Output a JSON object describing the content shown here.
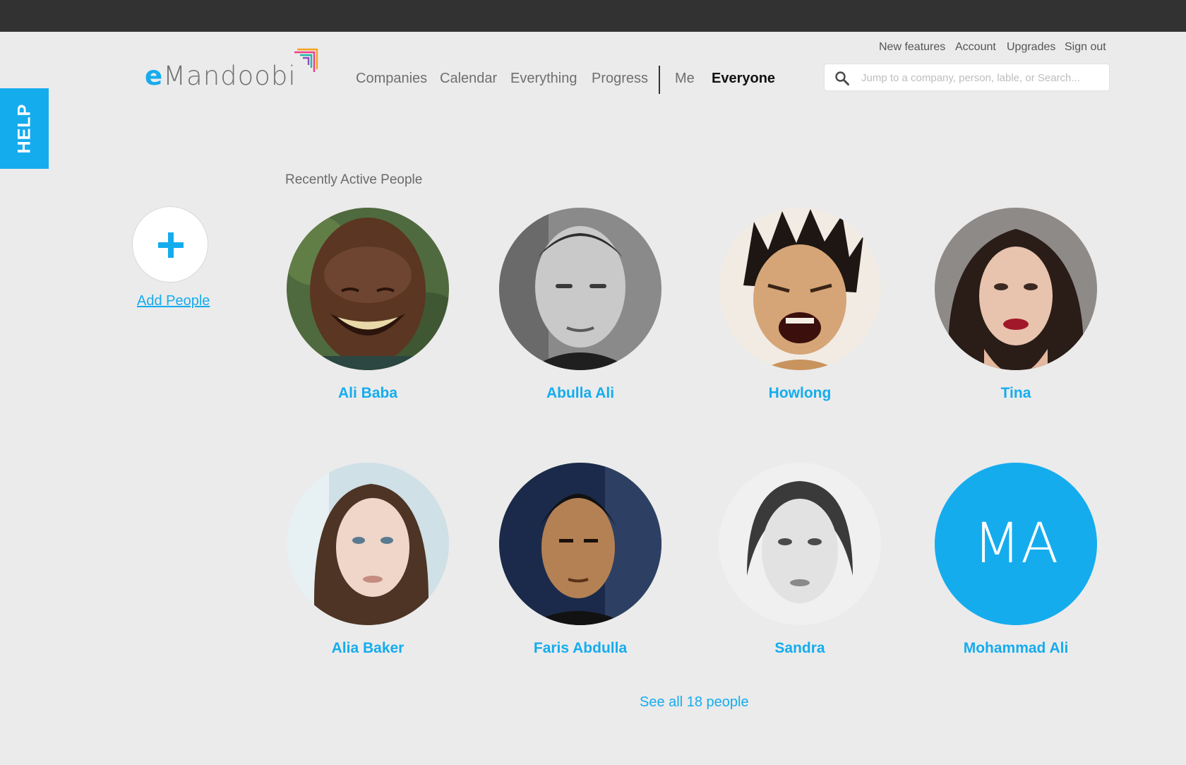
{
  "header": {
    "logo": {
      "e": "e",
      "rest": "Mandoobi"
    },
    "utility_links": [
      "New features",
      "Account",
      "Upgrades",
      "Sign out"
    ],
    "nav": [
      "Companies",
      "Calendar",
      "Everything",
      "Progress",
      "Me",
      "Everyone"
    ],
    "active_nav": "Everyone",
    "search": {
      "placeholder": "Jump to a company, person, lable, or Search..."
    }
  },
  "help_tab": {
    "label": "HELP"
  },
  "main": {
    "section_title": "Recently Active People",
    "add_people": {
      "label": "Add People"
    },
    "people": [
      {
        "name": "Ali Baba",
        "type": "photo"
      },
      {
        "name": "Abulla Ali",
        "type": "photo"
      },
      {
        "name": "Howlong",
        "type": "photo"
      },
      {
        "name": "Tina",
        "type": "photo"
      },
      {
        "name": "Alia Baker",
        "type": "photo"
      },
      {
        "name": "Faris Abdulla",
        "type": "photo"
      },
      {
        "name": "Sandra",
        "type": "photo"
      },
      {
        "name": "Mohammad Ali",
        "type": "initials",
        "initials": "MA"
      }
    ],
    "see_all": "See all 18 people"
  },
  "colors": {
    "accent": "#15acee",
    "topbar": "#323232",
    "background": "#ebebeb"
  }
}
